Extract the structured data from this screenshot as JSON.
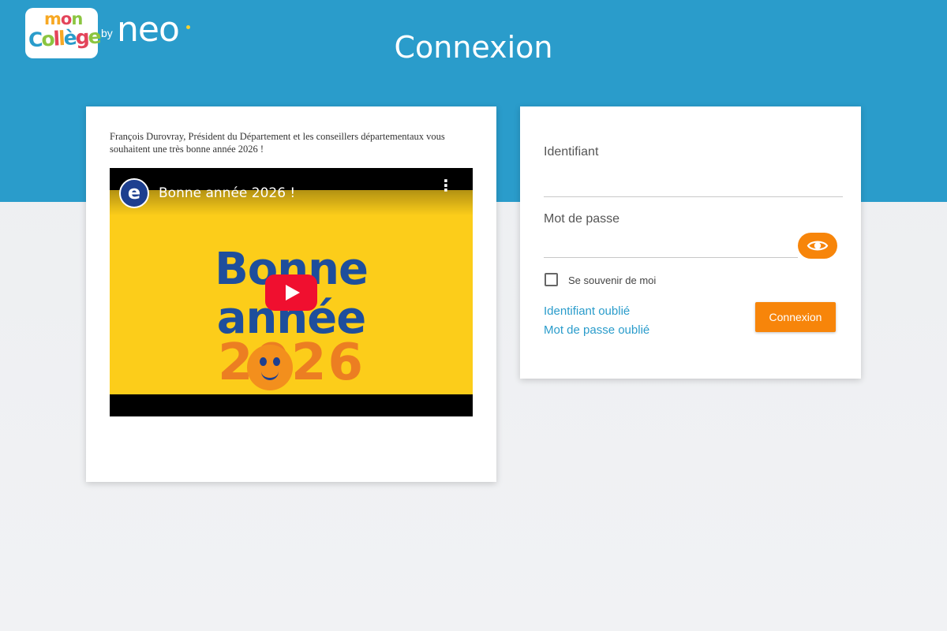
{
  "header": {
    "title": "Connexion",
    "logo": {
      "mon": [
        "m",
        "o",
        "n"
      ],
      "college": [
        "C",
        "o",
        "l",
        "l",
        "è",
        "g",
        "e"
      ],
      "by": "by",
      "neo": "neo"
    }
  },
  "news": {
    "text": "François Durovray, Président du Département et les conseillers départementaux vous souhaitent une très bonne année 2026 !",
    "video": {
      "channel_icon": "e",
      "title": "Bonne année 2026 !",
      "menu_icon": "⋮",
      "greeting_line1": "Bonne",
      "greeting_line2": "année",
      "greeting_year": "2026",
      "play_icon": "play-icon"
    }
  },
  "login": {
    "identifiant_label": "Identifiant",
    "identifiant_value": "",
    "password_label": "Mot de passe",
    "password_value": "",
    "remember_label": "Se souvenir de moi",
    "remember_checked": false,
    "forgot_identifiant": "Identifiant oublié",
    "forgot_password": "Mot de passe oublié",
    "submit_label": "Connexion",
    "show_password_icon": "eye-icon"
  },
  "colors": {
    "header_blue": "#2a9ccb",
    "accent_orange": "#f7850a",
    "link_blue": "#2a9ccb",
    "youtube_red": "#f00f2f"
  }
}
